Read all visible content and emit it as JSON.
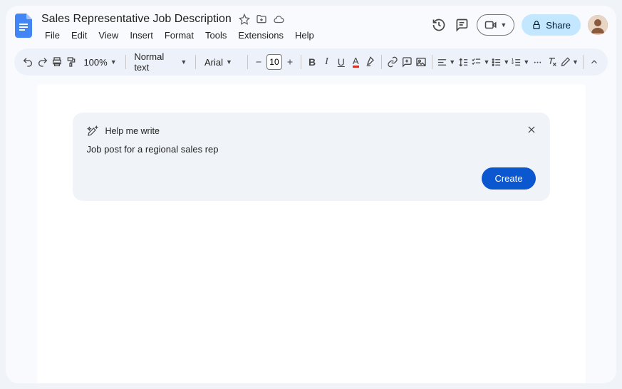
{
  "doc": {
    "title": "Sales Representative Job Description"
  },
  "menus": [
    "File",
    "Edit",
    "View",
    "Insert",
    "Format",
    "Tools",
    "Extensions",
    "Help"
  ],
  "header": {
    "share_label": "Share"
  },
  "toolbar": {
    "zoom": "100%",
    "style_label": "Normal text",
    "font_label": "Arial",
    "font_size": "10"
  },
  "help_me_write": {
    "title": "Help me write",
    "input_value": "Job post for a regional sales rep",
    "create_label": "Create"
  }
}
